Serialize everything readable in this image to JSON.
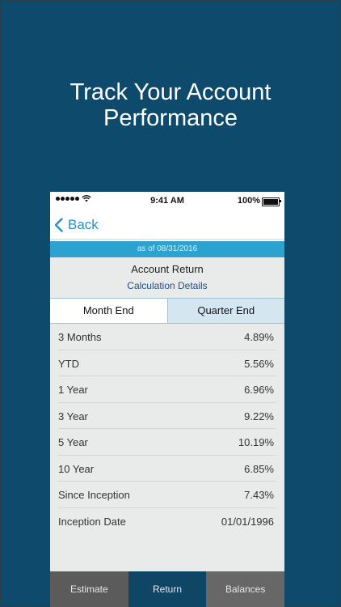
{
  "headline": {
    "line1": "Track Your Account",
    "line2": "Performance"
  },
  "status_bar": {
    "time": "9:41 AM",
    "battery": "100%"
  },
  "nav": {
    "back_label": "Back"
  },
  "as_of": "as of 08/31/2016",
  "account_return_title": "Account Return",
  "calc_details_link": "Calculation Details",
  "segments": {
    "month_end": "Month End",
    "quarter_end": "Quarter End",
    "selected": "Month End"
  },
  "returns": [
    {
      "label": "3 Months",
      "value": "4.89%"
    },
    {
      "label": "YTD",
      "value": "5.56%"
    },
    {
      "label": "1 Year",
      "value": "6.96%"
    },
    {
      "label": "3 Year",
      "value": "9.22%"
    },
    {
      "label": "5 Year",
      "value": "10.19%"
    },
    {
      "label": "10 Year",
      "value": "6.85%"
    },
    {
      "label": "Since Inception",
      "value": "7.43%"
    },
    {
      "label": "Inception Date",
      "value": "01/01/1996"
    }
  ],
  "tabs": {
    "estimate": "Estimate",
    "return": "Return",
    "balances": "Balances",
    "selected": "Return"
  },
  "colors": {
    "background": "#0d4a6b",
    "accent": "#2ca3cf",
    "link": "#2a8fc6",
    "tab_selected": "#0f4666"
  }
}
